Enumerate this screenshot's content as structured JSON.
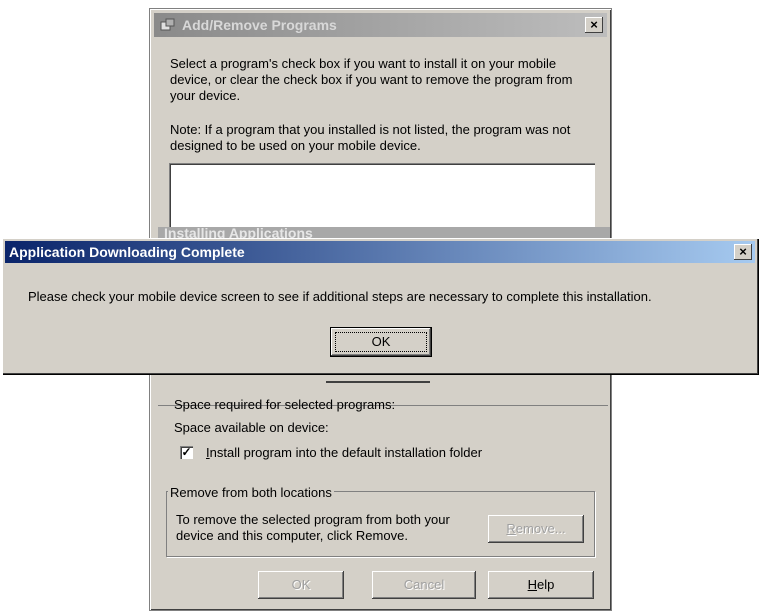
{
  "background_window": {
    "title": "Add/Remove Programs",
    "close_glyph": "×",
    "instructions": "Select a program's check box if you want to install it on your mobile device, or clear the check box if you want to remove the program from your device.",
    "note": "Note:  If a program that you installed is not listed, the program was not designed to be used on your mobile device.",
    "obscured_title": "Installing Applications",
    "space_required_label": "Space required for selected programs:",
    "space_available_label": "Space available on device:",
    "default_folder_checkbox": {
      "checked": true,
      "check_glyph": "✓",
      "label_mnemonic": "I",
      "label_rest": "nstall program into the default installation folder"
    },
    "remove_group": {
      "legend": "Remove from both locations",
      "text": "To remove the selected program from both your device and this computer, click Remove.",
      "remove_button_mnemonic": "R",
      "remove_button_rest": "emove..."
    },
    "buttons": {
      "ok": "OK",
      "cancel": "Cancel",
      "help_mnemonic": "H",
      "help_rest": "elp"
    }
  },
  "dialog": {
    "title": "Application Downloading Complete",
    "close_glyph": "×",
    "message": "Please check your mobile device screen to see if additional steps are necessary to complete this installation.",
    "ok_label": "OK"
  },
  "colors": {
    "active_titlebar": "#0a246a",
    "inactive_titlebar": "#8a8a8a",
    "window_face": "#d4d0c8"
  }
}
